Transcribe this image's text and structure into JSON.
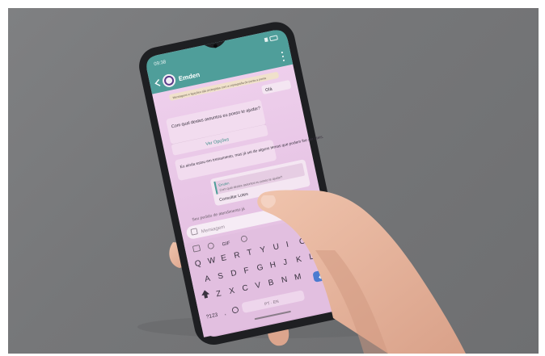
{
  "colors": {
    "background": "#7a7b7d",
    "phone_frame": "#1e1f22",
    "screen": "#e8c6e6",
    "header": "#4f9e9a",
    "bubble": "#f2dcef",
    "skin": "#e9b8a0",
    "send_button": "#3c9c8f",
    "enter_key": "#4a7bd0"
  },
  "status_bar": {
    "time": "09:38"
  },
  "chat": {
    "contact_name": "Emden",
    "banner": "Mensagens e ligações são protegidas com a criptografia de ponta a ponta",
    "sent_greeting": "Olá",
    "bot_question": "Com qual destes assuntos eu posso te ajudar?",
    "list_button": "Ver Opções",
    "bot_note": "Eu ainda estou em treinamento, mas já sei de alguns temas que podem lhe ser úteis.",
    "reply_quote_author": "Emden",
    "reply_quote_text": "Com qual destes assuntos eu posso te ajudar?",
    "reply_text": "Consultar Lotes",
    "draft_text": "Seu pedido de atendimento já"
  },
  "composer": {
    "placeholder": "Mensagem"
  },
  "keyboard": {
    "toolbar": [
      "GIF"
    ],
    "row1": [
      "Q",
      "W",
      "E",
      "R",
      "T",
      "Y",
      "U",
      "I",
      "O",
      "P"
    ],
    "row2": [
      "A",
      "S",
      "D",
      "F",
      "G",
      "H",
      "J",
      "K",
      "L"
    ],
    "row3": [
      "Z",
      "X",
      "C",
      "V",
      "B",
      "N",
      "M"
    ],
    "symbols_key": "?123",
    "comma": ",",
    "space_label": "PT · EN"
  }
}
